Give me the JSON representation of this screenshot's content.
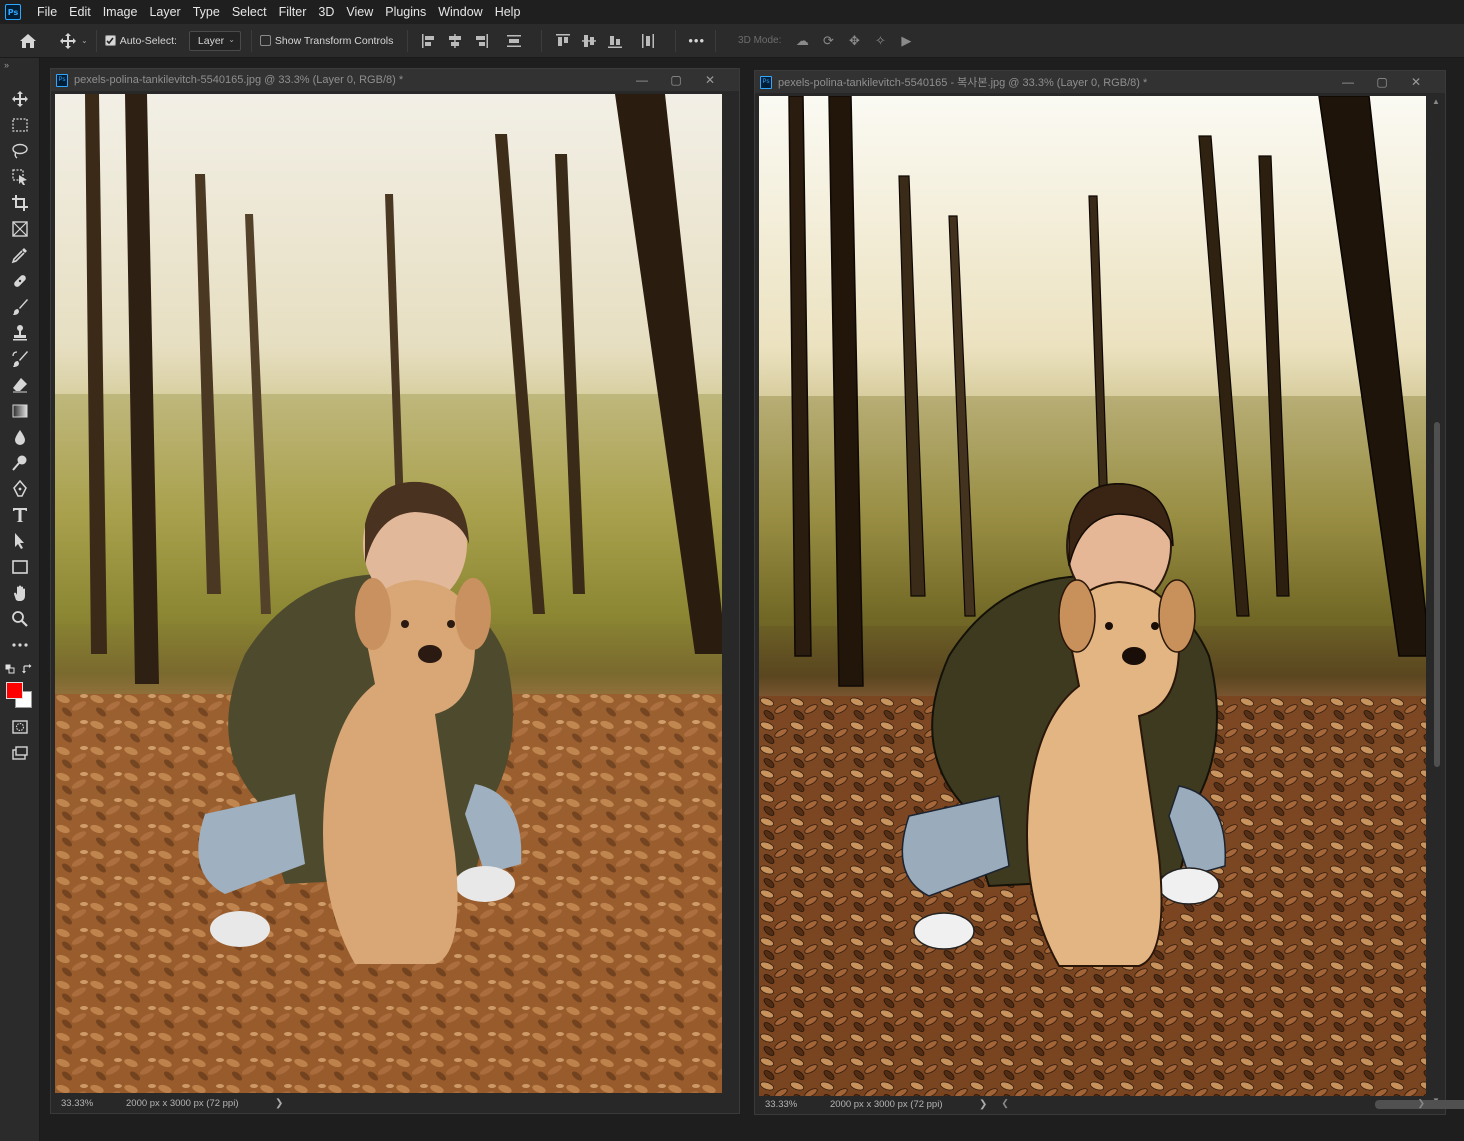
{
  "menu": {
    "logo": "Ps",
    "items": [
      "File",
      "Edit",
      "Image",
      "Layer",
      "Type",
      "Select",
      "Filter",
      "3D",
      "View",
      "Plugins",
      "Window",
      "Help"
    ]
  },
  "options": {
    "auto_select_label": "Auto-Select:",
    "auto_select_checked": true,
    "auto_select_target": "Layer",
    "show_transform_label": "Show Transform Controls",
    "show_transform_checked": false,
    "more_label": "•••",
    "mode_3d_label": "3D Mode:"
  },
  "toolbar": {
    "foreground_color": "#ff0000",
    "background_color": "#ffffff",
    "tools": [
      "move-tool",
      "marquee-tool",
      "lasso-tool",
      "object-select-tool",
      "crop-tool",
      "frame-tool",
      "eyedropper-tool",
      "healing-brush-tool",
      "brush-tool",
      "clone-stamp-tool",
      "history-brush-tool",
      "eraser-tool",
      "gradient-tool",
      "blur-tool",
      "dodge-tool",
      "pen-tool",
      "type-tool",
      "path-select-tool",
      "rectangle-tool",
      "hand-tool",
      "zoom-tool",
      "more-tools"
    ]
  },
  "documents": [
    {
      "title": "pexels-polina-tankilevitch-5540165.jpg @ 33.3% (Layer 0, RGB/8) *",
      "zoom": "33.33%",
      "dimensions": "2000 px x 3000 px (72 ppi)"
    },
    {
      "title": "pexels-polina-tankilevitch-5540165 - 복사본.jpg @ 33.3% (Layer 0, RGB/8) *",
      "zoom": "33.33%",
      "dimensions": "2000 px x 3000 px (72 ppi)"
    }
  ],
  "window_buttons": {
    "minimize": "—",
    "maximize": "▢",
    "close": "✕"
  }
}
